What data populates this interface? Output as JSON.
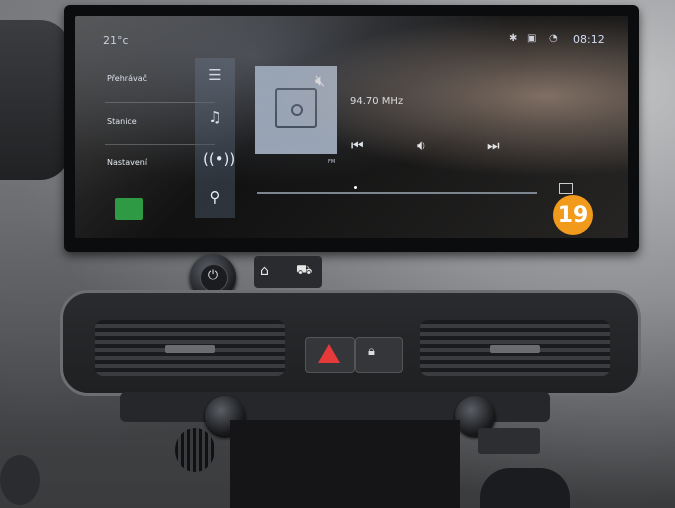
{
  "screen": {
    "temperature": "21°c",
    "clock": "08:12",
    "status_icons": [
      "bluetooth-icon",
      "car-icon",
      "phone-signal-icon"
    ],
    "menu": [
      {
        "label": "Přehrávač",
        "icon": "hamburger-icon"
      },
      {
        "label": "Stanice",
        "icon": "music-note-icon"
      },
      {
        "label": "Nastavení",
        "icon": "radio-antenna-icon"
      }
    ],
    "side_search_icon": "search-icon",
    "radio": {
      "frequency": "94.70 MHz",
      "band": "FM",
      "muted": true
    },
    "controls": [
      "previous-icon",
      "volume-icon",
      "next-icon"
    ],
    "progress": 0.35
  },
  "overlay_badge": "19",
  "physical_controls": [
    "power-knob",
    "home-button",
    "car-button",
    "hazard-button",
    "lock-button"
  ]
}
